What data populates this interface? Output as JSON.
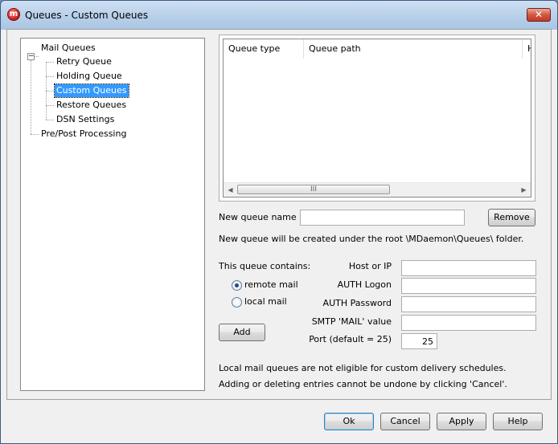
{
  "window": {
    "title": "Queues - Custom Queues"
  },
  "tree": {
    "root_label": "Mail Queues",
    "toggle_symbol": "−",
    "children": [
      "Retry Queue",
      "Holding Queue",
      "Custom Queues",
      "Restore Queues",
      "DSN Settings"
    ],
    "selected": "Custom Queues",
    "other_root_label": "Pre/Post Processing"
  },
  "queue_list": {
    "columns": [
      "Queue type",
      "Queue path",
      "H"
    ],
    "rows": [],
    "scroll_grip": "III"
  },
  "new_queue": {
    "label": "New queue name",
    "value": "",
    "remove_label": "Remove",
    "note": "New queue will be created under the root \\MDaemon\\Queues\\ folder."
  },
  "contains": {
    "label": "This queue contains:",
    "options": [
      "remote mail",
      "local mail"
    ],
    "selected": "remote mail",
    "add_label": "Add"
  },
  "fields": [
    {
      "label": "Host or IP",
      "value": ""
    },
    {
      "label": "AUTH Logon",
      "value": ""
    },
    {
      "label": "AUTH Password",
      "value": ""
    },
    {
      "label": "SMTP 'MAIL' value",
      "value": ""
    }
  ],
  "port": {
    "label": "Port (default = 25)",
    "value": "25"
  },
  "notes": [
    "Local mail queues are not eligible for custom delivery schedules.",
    "Adding or deleting entries cannot be undone by clicking 'Cancel'."
  ],
  "buttons": {
    "ok": "Ok",
    "cancel": "Cancel",
    "apply": "Apply",
    "help": "Help"
  },
  "icons": {
    "app": "mdaemon-app-icon",
    "close": "close-icon"
  },
  "close_glyph": "✕",
  "app_glyph": "m"
}
